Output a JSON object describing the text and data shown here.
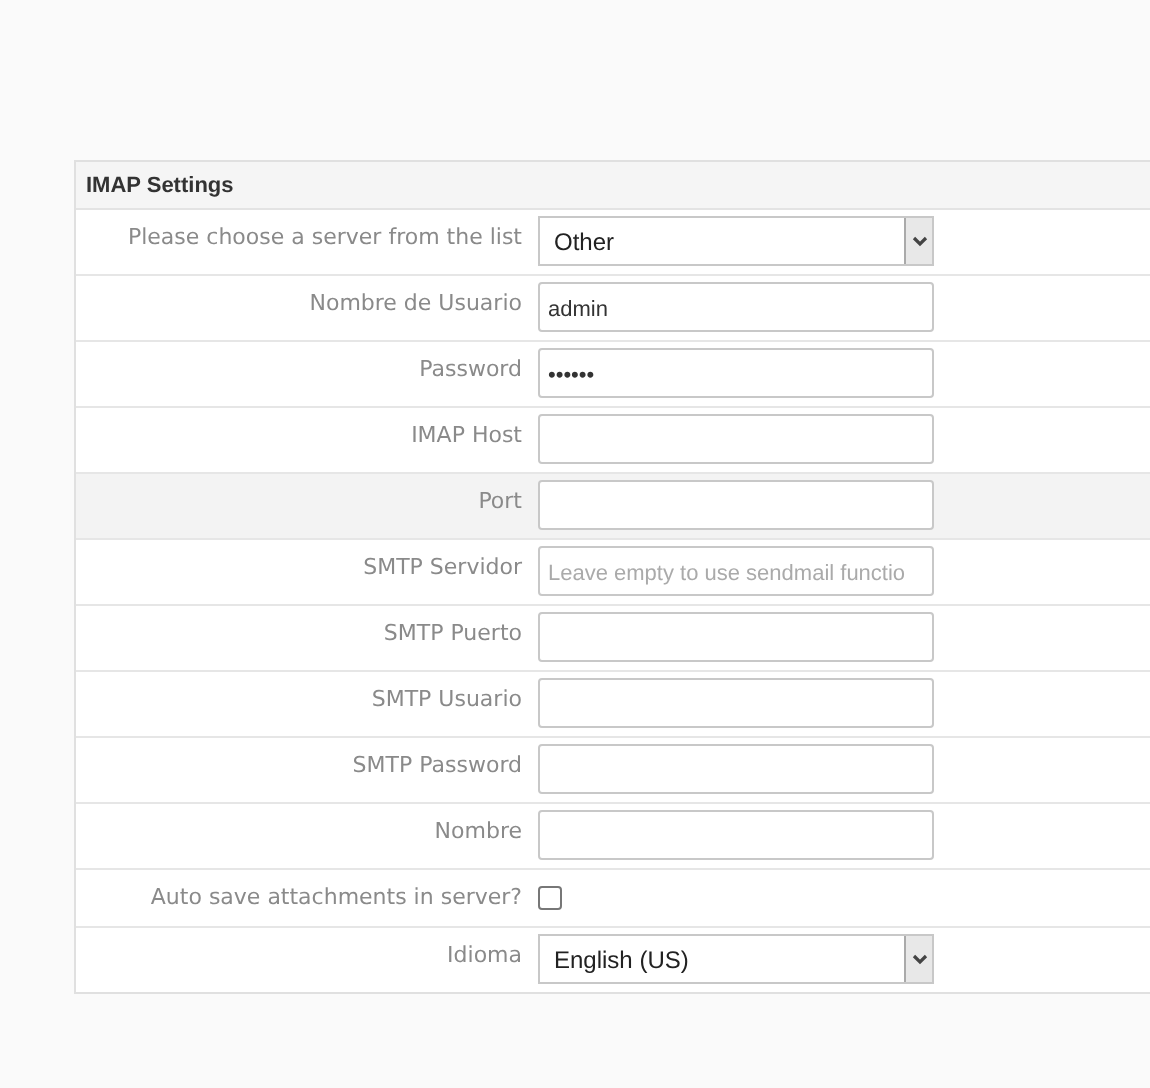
{
  "panel": {
    "title": "IMAP Settings"
  },
  "rows": [
    {
      "kind": "select",
      "label": "Please choose a server from the list",
      "value": "Other",
      "highlighted": false
    },
    {
      "kind": "text",
      "label": "Nombre de Usuario",
      "value": "admin",
      "highlighted": false
    },
    {
      "kind": "text",
      "label": "Password",
      "value": "••••••",
      "highlighted": false
    },
    {
      "kind": "text",
      "label": "IMAP Host",
      "highlighted": false
    },
    {
      "kind": "text",
      "label": "Port",
      "highlighted": true
    },
    {
      "kind": "text",
      "label": "SMTP Servidor",
      "placeholder": "Leave empty to use sendmail functio",
      "highlighted": false
    },
    {
      "kind": "text",
      "label": "SMTP Puerto",
      "highlighted": false
    },
    {
      "kind": "text",
      "label": "SMTP Usuario",
      "highlighted": false
    },
    {
      "kind": "text",
      "label": "SMTP Password",
      "highlighted": false
    },
    {
      "kind": "text",
      "label": "Nombre",
      "highlighted": false
    },
    {
      "kind": "checkbox",
      "label": "Auto save attachments in server?",
      "checked": false,
      "highlighted": false
    },
    {
      "kind": "select",
      "label": "Idioma",
      "value": "English (US)",
      "highlighted": false
    }
  ]
}
